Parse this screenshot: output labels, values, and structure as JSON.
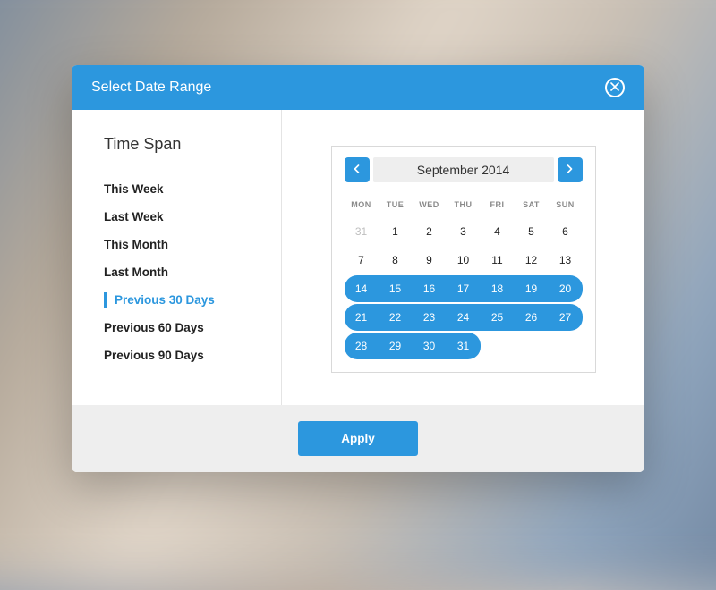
{
  "modal": {
    "title": "Select Date Range",
    "apply_label": "Apply"
  },
  "sidebar": {
    "title": "Time Span",
    "active_index": 4,
    "options": [
      "This Week",
      "Last Week",
      "This Month",
      "Last Month",
      "Previous 30 Days",
      "Previous 60 Days",
      "Previous 90 Days"
    ]
  },
  "calendar": {
    "month_label": "September 2014",
    "dow": [
      "MON",
      "TUE",
      "WED",
      "THU",
      "FRI",
      "SAT",
      "SUN"
    ],
    "days": [
      {
        "n": 31,
        "other": true
      },
      {
        "n": 1
      },
      {
        "n": 2
      },
      {
        "n": 3
      },
      {
        "n": 4
      },
      {
        "n": 5
      },
      {
        "n": 6
      },
      {
        "n": 7
      },
      {
        "n": 8
      },
      {
        "n": 9
      },
      {
        "n": 10
      },
      {
        "n": 11
      },
      {
        "n": 12
      },
      {
        "n": 13
      },
      {
        "n": 14,
        "sel": true,
        "start": true
      },
      {
        "n": 15,
        "sel": true
      },
      {
        "n": 16,
        "sel": true
      },
      {
        "n": 17,
        "sel": true
      },
      {
        "n": 18,
        "sel": true
      },
      {
        "n": 19,
        "sel": true
      },
      {
        "n": 20,
        "sel": true,
        "end": true
      },
      {
        "n": 21,
        "sel": true,
        "start": true
      },
      {
        "n": 22,
        "sel": true
      },
      {
        "n": 23,
        "sel": true
      },
      {
        "n": 24,
        "sel": true
      },
      {
        "n": 25,
        "sel": true
      },
      {
        "n": 26,
        "sel": true
      },
      {
        "n": 27,
        "sel": true,
        "end": true
      },
      {
        "n": 28,
        "sel": true,
        "start": true
      },
      {
        "n": 29,
        "sel": true
      },
      {
        "n": 30,
        "sel": true
      },
      {
        "n": 31,
        "sel": true,
        "end": true
      }
    ]
  },
  "colors": {
    "accent": "#2c97de"
  }
}
